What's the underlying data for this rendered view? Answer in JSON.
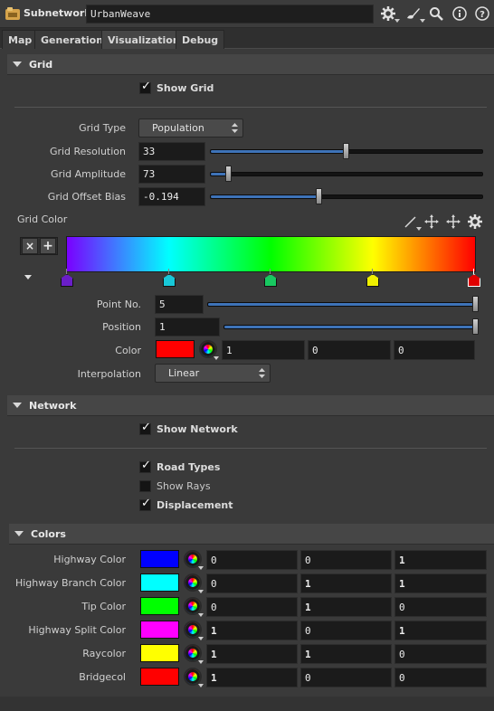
{
  "header": {
    "node_type": "Subnetwork",
    "node_name": "UrbanWeave",
    "icons": [
      "gear-icon",
      "brush-icon",
      "search-icon",
      "info-icon",
      "help-icon"
    ]
  },
  "tabs": [
    {
      "label": "Map",
      "active": false
    },
    {
      "label": "Generation",
      "active": false
    },
    {
      "label": "Visualization",
      "active": true
    },
    {
      "label": "Debug",
      "active": false
    }
  ],
  "grid": {
    "title": "Grid",
    "show_grid_label": "Show Grid",
    "show_grid_checked": true,
    "grid_type_label": "Grid Type",
    "grid_type_value": "Population",
    "resolution_label": "Grid Resolution",
    "resolution_value": "33",
    "resolution_fraction": 0.5,
    "amplitude_label": "Grid Amplitude",
    "amplitude_value": "73",
    "amplitude_fraction": 0.07,
    "offset_label": "Grid Offset Bias",
    "offset_value": "-0.194",
    "offset_fraction": 0.4,
    "color_label": "Grid Color",
    "ramp": {
      "stops": [
        "#7a00ff",
        "#00ffff",
        "#00ff00",
        "#ffff00",
        "#ff0000"
      ],
      "pins": [
        "#6a1ec8",
        "#18c8d8",
        "#18c860",
        "#f0f000",
        "#e00000"
      ],
      "remove_label": "×",
      "add_label": "+"
    },
    "point_no_label": "Point No.",
    "point_no_value": "5",
    "point_no_fraction": 1.0,
    "position_label": "Position",
    "position_value": "1",
    "position_fraction": 1.0,
    "color_point_label": "Color",
    "color_point_hex": "#ff0000",
    "color_point_values": [
      "1",
      "0",
      "0"
    ],
    "interpolation_label": "Interpolation",
    "interpolation_value": "Linear"
  },
  "network": {
    "title": "Network",
    "show_network_label": "Show Network",
    "road_types_label": "Road Types",
    "show_rays_label": "Show Rays",
    "displacement_label": "Displacement"
  },
  "colors": {
    "title": "Colors",
    "rows": [
      {
        "label": "Highway Color",
        "hex": "#0000ff",
        "r": "0",
        "g": "0",
        "b": "1"
      },
      {
        "label": "Highway Branch Color",
        "hex": "#00ffff",
        "r": "0",
        "g": "1",
        "b": "1"
      },
      {
        "label": "Tip Color",
        "hex": "#00ff00",
        "r": "0",
        "g": "1",
        "b": "0"
      },
      {
        "label": "Highway Split Color",
        "hex": "#ff00ff",
        "r": "1",
        "g": "0",
        "b": "1"
      },
      {
        "label": "Raycolor",
        "hex": "#ffff00",
        "r": "1",
        "g": "1",
        "b": "0"
      },
      {
        "label": "Bridgecol",
        "hex": "#ff0000",
        "r": "1",
        "g": "0",
        "b": "0"
      }
    ]
  }
}
